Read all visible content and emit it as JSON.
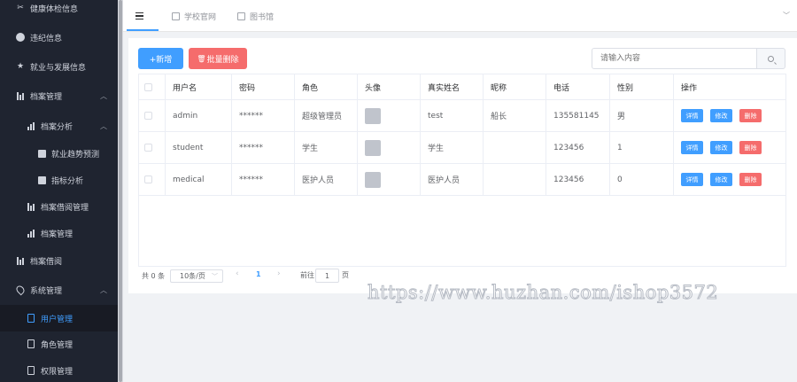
{
  "sidebar": {
    "items": [
      {
        "label": "健康体检信息",
        "icon": "scissors-icon"
      },
      {
        "label": "违纪信息",
        "icon": "info-circle-icon"
      },
      {
        "label": "就业与发展信息",
        "icon": "star-icon"
      },
      {
        "label": "档案管理",
        "icon": "bar-chart-icon"
      },
      {
        "label": "档案分析",
        "icon": "chart-icon"
      },
      {
        "label": "就业趋势预测",
        "icon": "check-square-icon"
      },
      {
        "label": "指标分析",
        "icon": "check-square-icon"
      },
      {
        "label": "档案借阅管理",
        "icon": "bar-chart-icon"
      },
      {
        "label": "档案管理",
        "icon": "chart-icon"
      },
      {
        "label": "档案借阅",
        "icon": "bar-chart-icon"
      },
      {
        "label": "系统管理",
        "icon": "location-icon"
      },
      {
        "label": "用户管理",
        "icon": "document-icon"
      },
      {
        "label": "角色管理",
        "icon": "document-icon"
      },
      {
        "label": "权限管理",
        "icon": "document-icon"
      }
    ]
  },
  "tabs": [
    {
      "label": "",
      "icon": "menu-icon"
    },
    {
      "label": "学校官网",
      "icon": "window-icon"
    },
    {
      "label": "图书馆",
      "icon": "copy-icon"
    }
  ],
  "toolbar": {
    "add_label": "+新增",
    "batch_delete_label": "批量删除",
    "search_placeholder": "请输入内容"
  },
  "table": {
    "headers": [
      "用户名",
      "密码",
      "角色",
      "头像",
      "真实姓名",
      "昵称",
      "电话",
      "性别",
      "操作"
    ],
    "rows": [
      {
        "username": "admin",
        "password": "******",
        "role": "超级管理员",
        "real_name": "test",
        "nickname": "船长",
        "phone": "135581145",
        "gender": "男"
      },
      {
        "username": "student",
        "password": "******",
        "role": "学生",
        "real_name": "学生",
        "nickname": "",
        "phone": "123456",
        "gender": "1"
      },
      {
        "username": "medical",
        "password": "******",
        "role": "医护人员",
        "real_name": "医护人员",
        "nickname": "",
        "phone": "123456",
        "gender": "0"
      }
    ],
    "actions": {
      "detail": "详情",
      "edit": "修改",
      "delete": "删除"
    }
  },
  "pagination": {
    "total": "共 0 条",
    "page_size": "10条/页",
    "current_page": "1",
    "goto_label": "前往",
    "goto_value": "1",
    "page_suffix": "页"
  },
  "watermark": "https://www.huzhan.com/ishop3572",
  "colors": {
    "primary": "#409eff",
    "danger": "#f56c6c",
    "sidebar_bg": "#1f2430"
  }
}
